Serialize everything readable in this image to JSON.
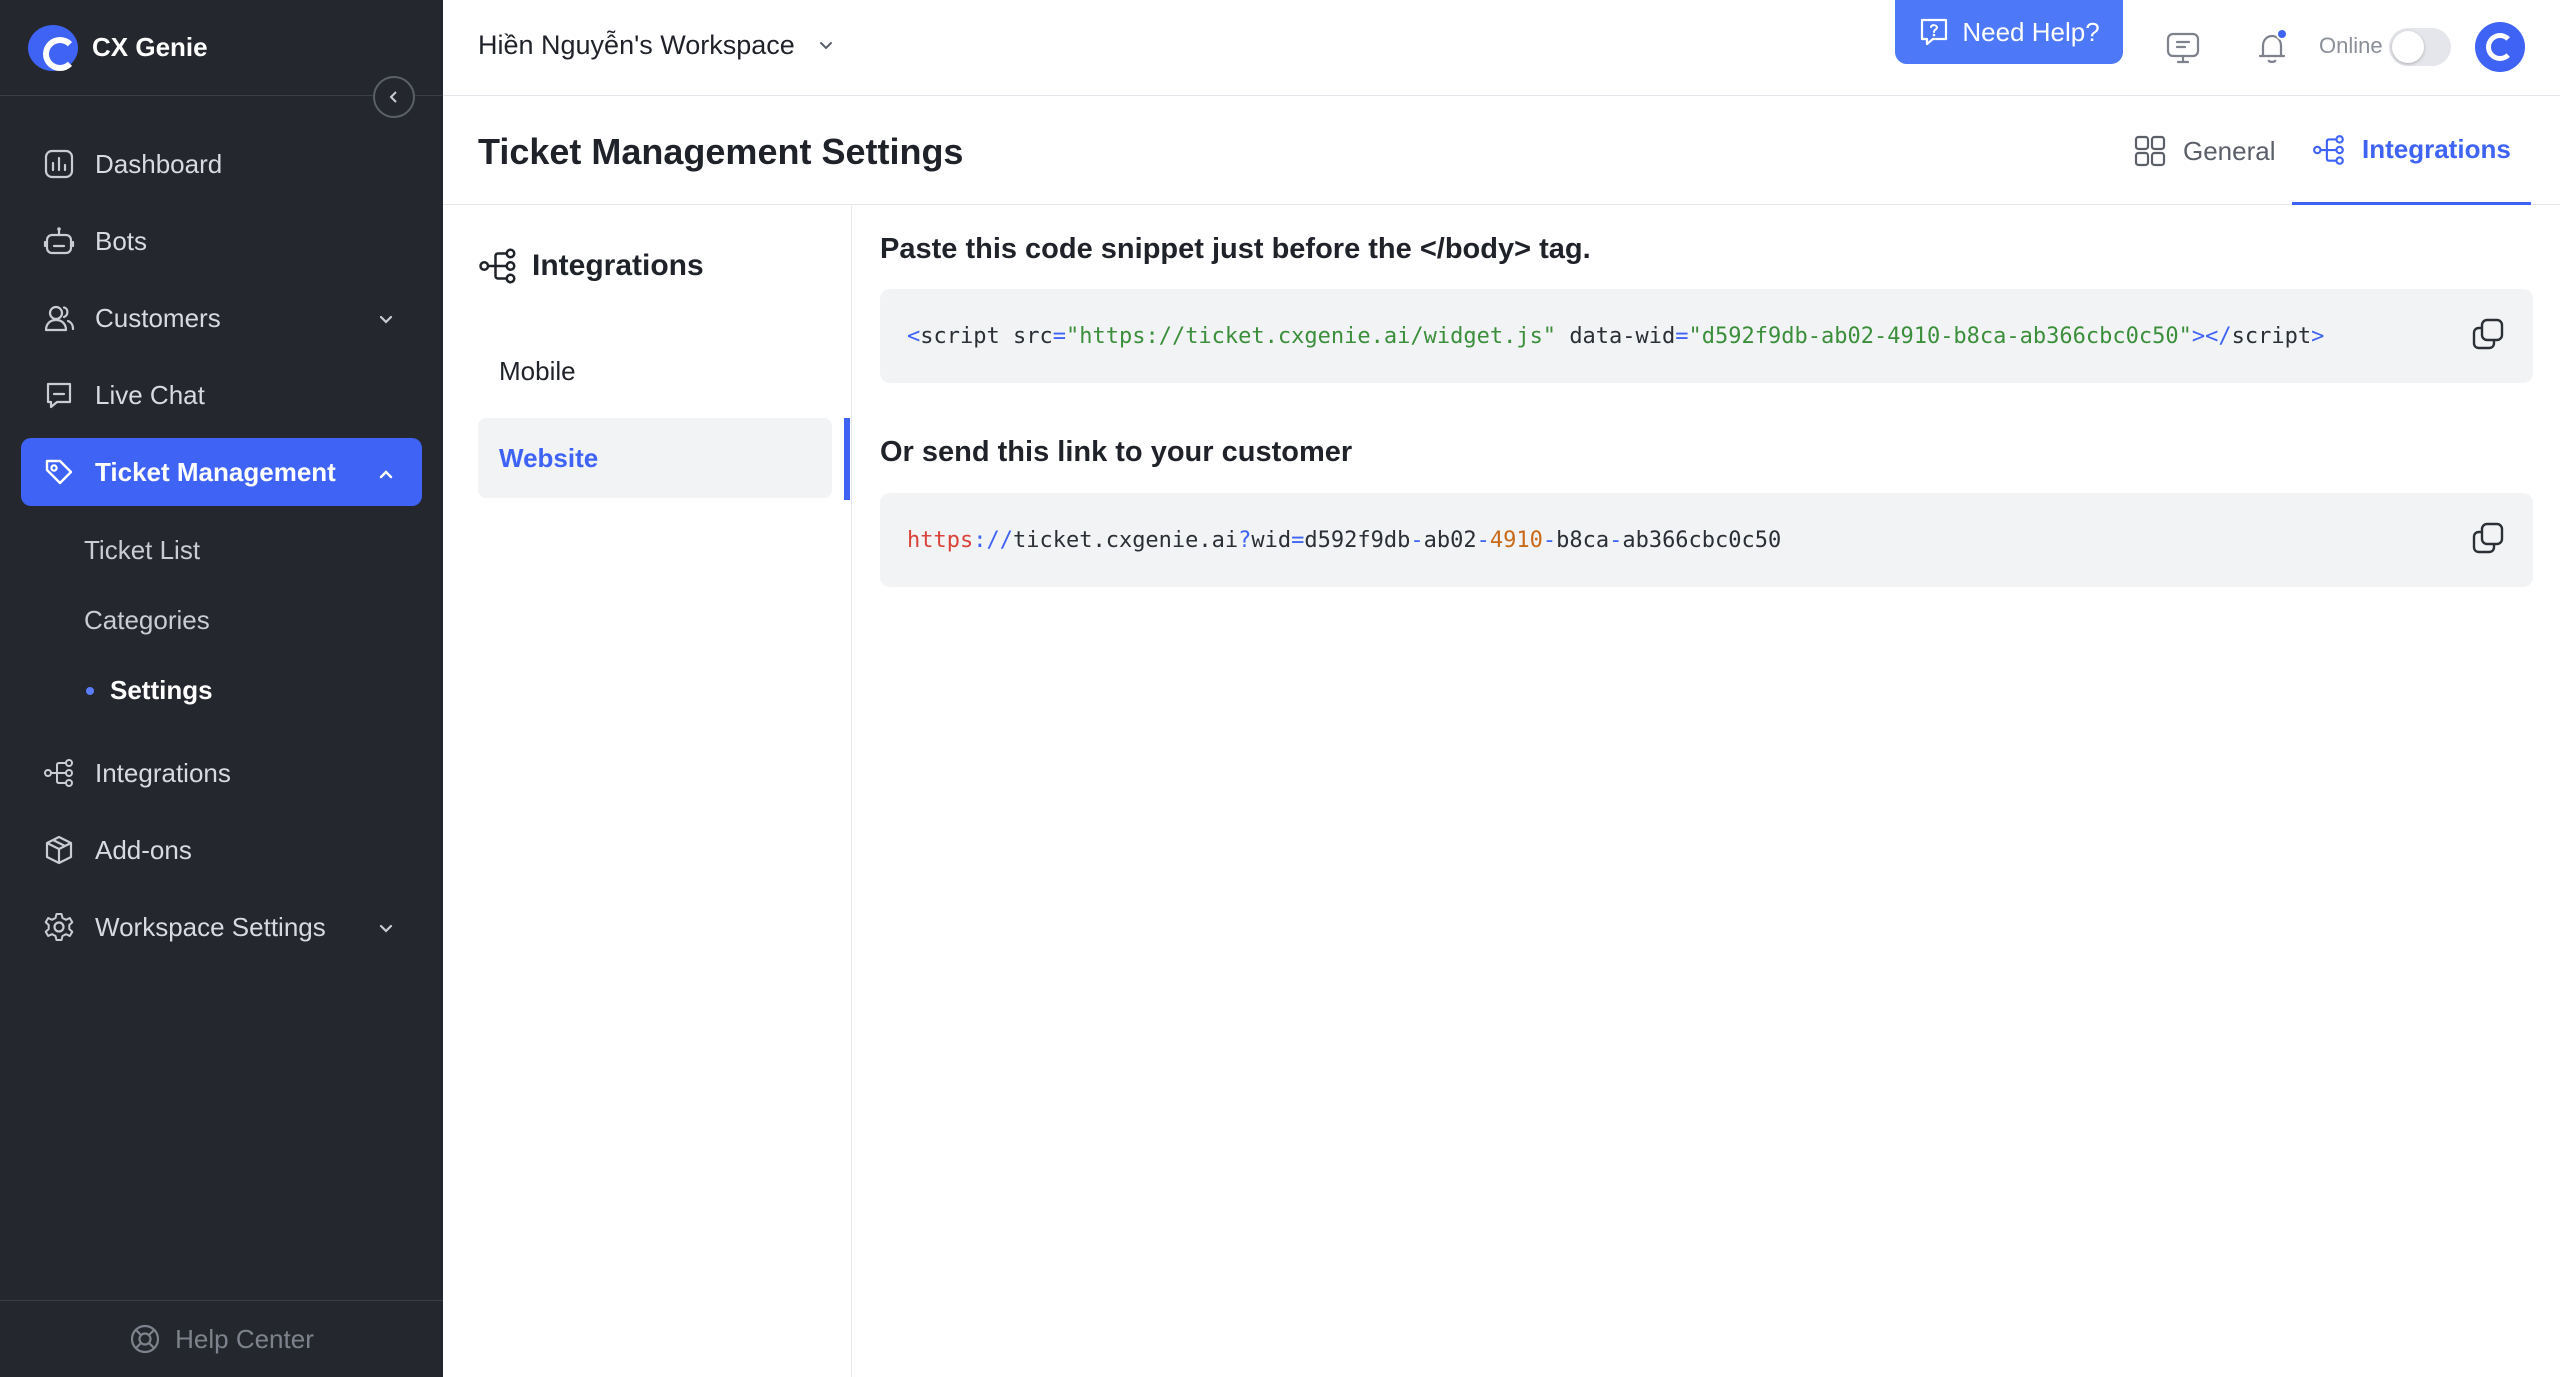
{
  "app": {
    "brand_name": "CX Genie",
    "accent": "#3f63f5"
  },
  "sidebar": {
    "items": [
      {
        "label": "Dashboard",
        "icon": "chart-icon"
      },
      {
        "label": "Bots",
        "icon": "bot-icon"
      },
      {
        "label": "Customers",
        "icon": "users-icon",
        "expandable": true
      },
      {
        "label": "Live Chat",
        "icon": "chat-icon"
      },
      {
        "label": "Ticket Management",
        "icon": "ticket-icon",
        "expanded": true,
        "active": true
      }
    ],
    "ticket_sub": [
      {
        "label": "Ticket List"
      },
      {
        "label": "Categories"
      },
      {
        "label": "Settings",
        "current": true
      }
    ],
    "items_after": [
      {
        "label": "Integrations",
        "icon": "integrations-icon"
      },
      {
        "label": "Add-ons",
        "icon": "box-icon"
      },
      {
        "label": "Workspace Settings",
        "icon": "gear-icon",
        "expandable": true
      }
    ],
    "help_center": "Help Center"
  },
  "header": {
    "workspace": "Hiền Nguyễn's Workspace",
    "need_help": "Need Help?",
    "online_label": "Online",
    "online_enabled": false
  },
  "page": {
    "title": "Ticket Management Settings",
    "tabs": [
      {
        "label": "General",
        "active": false
      },
      {
        "label": "Integrations",
        "active": true
      }
    ]
  },
  "inner_nav": {
    "title": "Integrations",
    "items": [
      {
        "label": "Mobile",
        "active": false
      },
      {
        "label": "Website",
        "active": true
      }
    ]
  },
  "content": {
    "snippet_title": "Paste this code snippet just before the </body> tag.",
    "snippet": {
      "open_tag": "script",
      "attr_src": "src",
      "src_value": "\"https://ticket.cxgenie.ai/widget.js\"",
      "attr_wid": "data-wid",
      "wid_value": "\"d592f9db-ab02-4910-b8ca-ab366cbc0c50\"",
      "close_tag": "script"
    },
    "link_title": "Or send this link to your customer",
    "link": {
      "scheme": "https",
      "sep": "://",
      "host": "ticket.cxgenie.ai",
      "q": "?",
      "param": "wid",
      "eq": "=",
      "seg1": "d592f9db",
      "seg2": "ab02",
      "seg3": "4910",
      "seg4": "b8ca",
      "seg5": "ab366cbc0c50",
      "dash": "-"
    }
  }
}
